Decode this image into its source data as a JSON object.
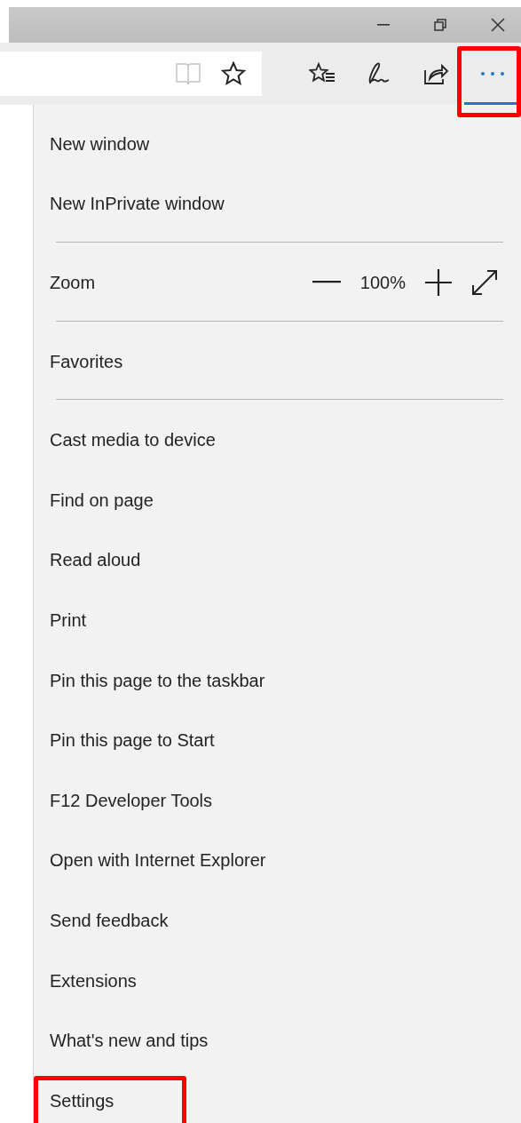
{
  "toolbar": {
    "address_buttons": [
      {
        "kind": "reading-view",
        "disabled": true
      },
      {
        "kind": "favorite",
        "disabled": false
      }
    ],
    "buttons": [
      {
        "kind": "hub",
        "selected": false,
        "highlighted": false
      },
      {
        "kind": "note",
        "selected": false,
        "highlighted": false
      },
      {
        "kind": "share",
        "selected": false,
        "highlighted": false
      },
      {
        "kind": "more",
        "selected": true,
        "highlighted": true
      }
    ]
  },
  "menu": {
    "items": [
      {
        "kind": "item",
        "label": "New window",
        "highlighted": false
      },
      {
        "kind": "item",
        "label": "New InPrivate window",
        "highlighted": false
      },
      {
        "kind": "divider"
      },
      {
        "kind": "zoom",
        "label": "Zoom",
        "value": "100%"
      },
      {
        "kind": "divider"
      },
      {
        "kind": "item",
        "label": "Favorites",
        "highlighted": false
      },
      {
        "kind": "divider"
      },
      {
        "kind": "item",
        "label": "Cast media to device",
        "highlighted": false
      },
      {
        "kind": "item",
        "label": "Find on page",
        "highlighted": false
      },
      {
        "kind": "item",
        "label": "Read aloud",
        "highlighted": false
      },
      {
        "kind": "item",
        "label": "Print",
        "highlighted": false
      },
      {
        "kind": "item",
        "label": "Pin this page to the taskbar",
        "highlighted": false
      },
      {
        "kind": "item",
        "label": "Pin this page to Start",
        "highlighted": false
      },
      {
        "kind": "item",
        "label": "F12 Developer Tools",
        "highlighted": false
      },
      {
        "kind": "item",
        "label": "Open with Internet Explorer",
        "highlighted": false
      },
      {
        "kind": "item",
        "label": "Send feedback",
        "highlighted": false
      },
      {
        "kind": "item",
        "label": "Extensions",
        "highlighted": false
      },
      {
        "kind": "item",
        "label": "What's new and tips",
        "highlighted": false
      },
      {
        "kind": "item",
        "label": "Settings",
        "highlighted": true
      }
    ]
  }
}
